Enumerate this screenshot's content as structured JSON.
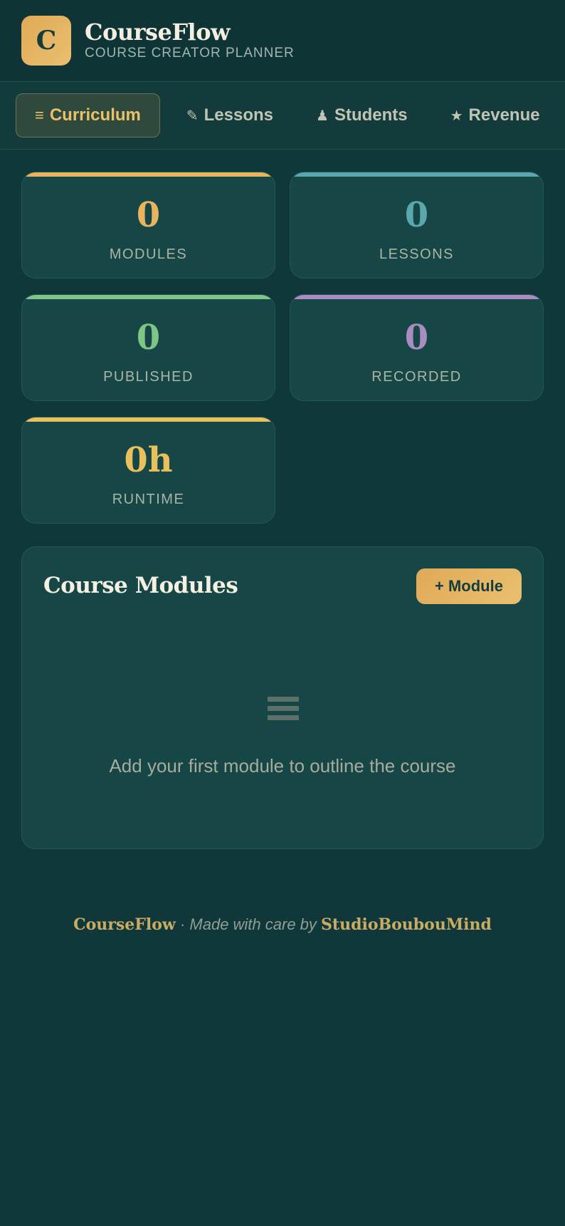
{
  "header": {
    "logo_letter": "C",
    "app_name": "CourseFlow",
    "tagline": "COURSE CREATOR PLANNER"
  },
  "nav": {
    "tabs": [
      {
        "icon": "≡",
        "label": "Curriculum",
        "active": true
      },
      {
        "icon": "✎",
        "label": "Lessons",
        "active": false
      },
      {
        "icon": "♟",
        "label": "Students",
        "active": false
      },
      {
        "icon": "★",
        "label": "Revenue",
        "active": false
      }
    ]
  },
  "stats": [
    {
      "value": "0",
      "label": "MODULES",
      "color": "#e8b45e"
    },
    {
      "value": "0",
      "label": "LESSONS",
      "color": "#5ba7ae"
    },
    {
      "value": "0",
      "label": "PUBLISHED",
      "color": "#7fc686"
    },
    {
      "value": "0",
      "label": "RECORDED",
      "color": "#a98dc0"
    },
    {
      "value": "0h",
      "label": "RUNTIME",
      "color": "#e8c05c"
    }
  ],
  "modules_panel": {
    "title": "Course Modules",
    "add_button": "+ Module",
    "empty_icon": "list-icon",
    "empty_text": "Add your first module to outline the course"
  },
  "footer": {
    "brand": "CourseFlow",
    "separator": " · ",
    "made_with": "Made with care by",
    "studio": "StudioBoubouMind"
  }
}
